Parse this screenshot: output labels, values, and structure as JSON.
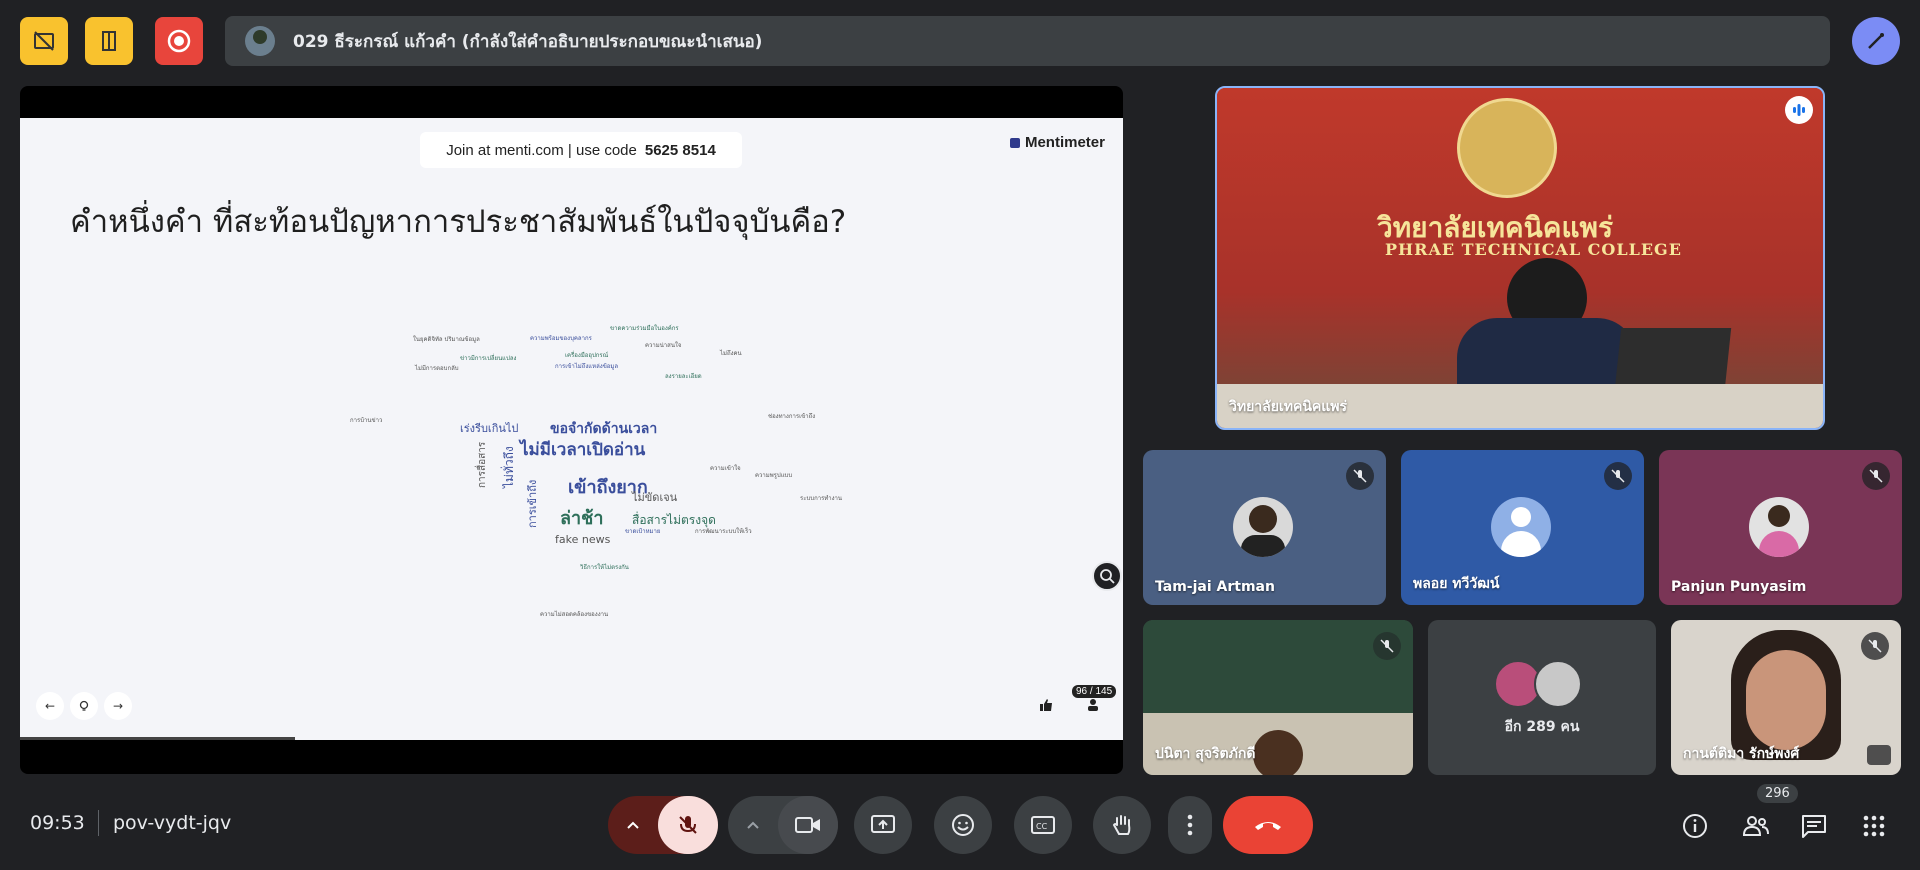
{
  "header": {
    "presenter_name": "029 ธีระกรณ์ แก้วคำ (กำลังใส่คำอธิบายประกอบขณะนำเสนอ)"
  },
  "slide": {
    "join_prefix": "Join at menti.com | use code",
    "join_code": "5625 8514",
    "brand": "Mentimeter",
    "question": "คำหนึ่งคำ ที่สะท้อนปัญหาการประชาสัมพันธ์ในปัจจุบันคือ?",
    "response_count": "96 / 145",
    "words": [
      {
        "text": "เข้าถึงยาก",
        "size": 18,
        "color": "#3a4e9c"
      },
      {
        "text": "ไม่มีเวลาเปิดอ่าน",
        "size": 17,
        "color": "#3a4e9c"
      },
      {
        "text": "ล่าช้า",
        "size": 18,
        "color": "#2e6f5a"
      },
      {
        "text": "ขอจำกัดด้านเวลา",
        "size": 14,
        "color": "#3a4e9c"
      },
      {
        "text": "เร่งรีบเกินไป",
        "size": 11,
        "color": "#3a4e9c"
      },
      {
        "text": "สื่อสารไม่ตรงจุด",
        "size": 12,
        "color": "#2e6f5a"
      },
      {
        "text": "ไม่ขัดเจน",
        "size": 11,
        "color": "#555"
      },
      {
        "text": "fake news",
        "size": 11,
        "color": "#555"
      },
      {
        "text": "การเข้าถึง",
        "size": 11,
        "color": "#3a4e9c"
      },
      {
        "text": "ไม่ทั่วถึง",
        "size": 12,
        "color": "#3a4e9c"
      },
      {
        "text": "การสื่อสาร",
        "size": 10,
        "color": "#555"
      },
      {
        "text": "ขาดความร่วมมือในองค์กร",
        "size": 6,
        "color": "#2e6f5a"
      },
      {
        "text": "ความพร้อมของบุคลากร",
        "size": 6,
        "color": "#3a4e9c"
      },
      {
        "text": "ความน่าสนใจ",
        "size": 6,
        "color": "#555"
      },
      {
        "text": "ในยุคดิจิทัล ปริมาณข้อมูล",
        "size": 6,
        "color": "#555"
      },
      {
        "text": "การเข้าไม่ถึงแหล่งข้อมูล",
        "size": 6,
        "color": "#3a4e9c"
      },
      {
        "text": "เครื่องมืออุปกรณ์",
        "size": 6,
        "color": "#2e6f5a"
      },
      {
        "text": "ข่าวมีการเปลี่ยนแปลง",
        "size": 6,
        "color": "#2e6f5a"
      },
      {
        "text": "ความเข้าใจ",
        "size": 6,
        "color": "#555"
      },
      {
        "text": "ไม่ถึงคน",
        "size": 6,
        "color": "#555"
      },
      {
        "text": "ไม่มีการตอบกลับ",
        "size": 6,
        "color": "#555"
      },
      {
        "text": "ความพรูปแบบ",
        "size": 6,
        "color": "#555"
      },
      {
        "text": "วิธีการให้ไม่ตรงกัน",
        "size": 6,
        "color": "#2e6f5a"
      },
      {
        "text": "ช่องทางการเข้าถึง",
        "size": 6,
        "color": "#555"
      },
      {
        "text": "การบ้านข่าว",
        "size": 6,
        "color": "#555"
      },
      {
        "text": "ขาดเป้าหมาย",
        "size": 6,
        "color": "#3a4e9c"
      },
      {
        "text": "การพัฒนาระบบให้เร็ว",
        "size": 6,
        "color": "#555"
      },
      {
        "text": "ความไม่สอดคล้องของงาน",
        "size": 6,
        "color": "#555"
      },
      {
        "text": "ลงรายละเอียด",
        "size": 6,
        "color": "#2e6f5a"
      },
      {
        "text": "ระบบการทำงาน",
        "size": 6,
        "color": "#555"
      }
    ]
  },
  "tiles": {
    "main_speaker": "วิทยาลัยเทคนิคแพร่",
    "p1": "Tam-jai Artman",
    "p2": "พลอย ทวีวัฒน์",
    "p3": "Panjun Punyasim",
    "p4": "ปนิตา สุจริตภักดี",
    "others": "อีก 289 คน",
    "p5": "กานต์ติมา รักษ์พงศ์"
  },
  "footer": {
    "time": "09:53",
    "meeting_code": "pov-vydt-jqv",
    "participant_count": "296"
  },
  "colors": {
    "background": "#202124",
    "accent_yellow": "#f9c22e",
    "end_call": "#ea4335"
  }
}
